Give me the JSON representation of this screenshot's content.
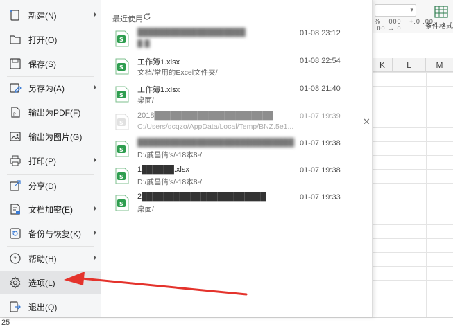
{
  "ribbon": {
    "number_format_buttons": [
      "%",
      "000",
      "+.0 .00",
      ".00 →.0"
    ],
    "conditional_format_label": "条件格式"
  },
  "sheet": {
    "columns": [
      "K",
      "L",
      "M"
    ],
    "visible_row_number": "25"
  },
  "nav": {
    "items": [
      {
        "label": "新建(N)",
        "icon": "new-file-icon",
        "has_submenu": true
      },
      {
        "label": "打开(O)",
        "icon": "folder-open-icon",
        "has_submenu": false
      },
      {
        "label": "保存(S)",
        "icon": "save-icon",
        "has_submenu": false
      },
      {
        "label": "另存为(A)",
        "icon": "save-as-icon",
        "has_submenu": true
      },
      {
        "label": "输出为PDF(F)",
        "icon": "pdf-export-icon",
        "has_submenu": false
      },
      {
        "label": "输出为图片(G)",
        "icon": "image-export-icon",
        "has_submenu": false
      },
      {
        "label": "打印(P)",
        "icon": "printer-icon",
        "has_submenu": true
      },
      {
        "label": "分享(D)",
        "icon": "share-icon",
        "has_submenu": false
      },
      {
        "label": "文档加密(E)",
        "icon": "encrypt-icon",
        "has_submenu": true
      },
      {
        "label": "备份与恢复(K)",
        "icon": "backup-icon",
        "has_submenu": true
      },
      {
        "label": "帮助(H)",
        "icon": "help-icon",
        "has_submenu": true
      },
      {
        "label": "选项(L)",
        "icon": "gear-icon",
        "has_submenu": false,
        "selected": true
      },
      {
        "label": "退出(Q)",
        "icon": "exit-icon",
        "has_submenu": false
      }
    ]
  },
  "recent": {
    "title": "最近使用",
    "files": [
      {
        "name": "████████████████████",
        "path": "█ █",
        "time": "01-08 23:12",
        "name_blurred": true,
        "path_blurred": true
      },
      {
        "name": "工作簿1.xlsx",
        "path": "文档/常用的Excel文件夹/",
        "time": "01-08 22:54"
      },
      {
        "name": "工作簿1.xlsx",
        "path": "桌面/",
        "time": "01-08 21:40"
      },
      {
        "name": "2018██████████████████████",
        "path": "C:/Users/qcqzo/AppData/Local/Temp/BNZ.5e1...",
        "time": "01-07 19:39",
        "name_blurred_suffix": true,
        "faded": true
      },
      {
        "name": "█████████████████████████████",
        "path": "D:/戚昌倩's/-18本8-/",
        "time": "01-07 19:38",
        "name_blurred": true
      },
      {
        "name": "1██████.xlsx",
        "path": "D:/戚昌倩's/-18本8-/",
        "time": "01-07 19:38",
        "name_partly_blurred": true
      },
      {
        "name": "2███████████████████████",
        "path": "桌面/",
        "time": "01-07 19:33",
        "name_blurred_suffix": true
      }
    ]
  },
  "colors": {
    "accent_green": "#2e9e4f",
    "selected_bg": "#e3e4e6",
    "annotation_red": "#e4332c"
  }
}
